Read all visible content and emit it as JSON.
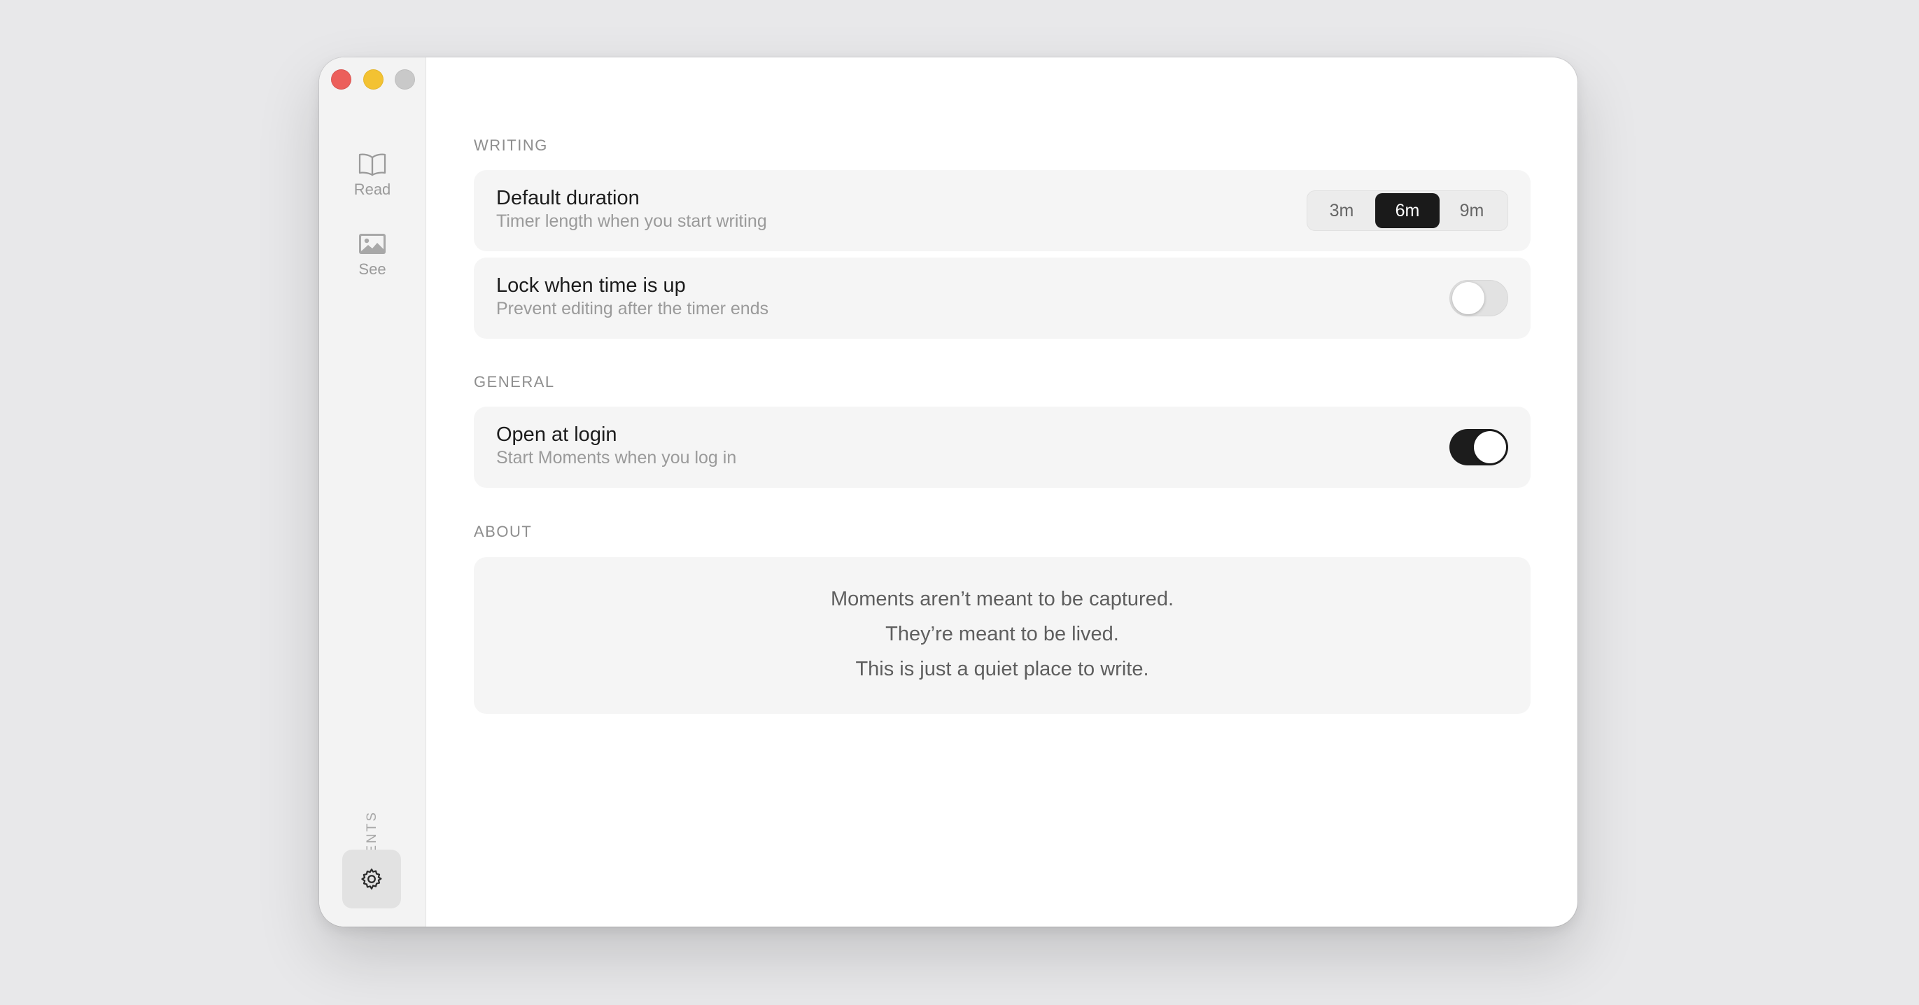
{
  "app": {
    "brand": "MOMENTS"
  },
  "window": {
    "traffic_lights": {
      "close": "#ec5f5b",
      "minimize": "#f3c232",
      "maximize": "#c9c9c9"
    }
  },
  "sidebar": {
    "items": [
      {
        "label": "Read",
        "icon": "book-icon"
      },
      {
        "label": "See",
        "icon": "image-icon"
      }
    ],
    "settings_icon": "gear-icon"
  },
  "settings": {
    "writing": {
      "title": "WRITING",
      "default_duration": {
        "title": "Default duration",
        "subtitle": "Timer length when you start writing",
        "options": [
          "3m",
          "6m",
          "9m"
        ],
        "selected": "6m"
      },
      "lock": {
        "title": "Lock when time is up",
        "subtitle": "Prevent editing after the timer ends",
        "enabled": false
      }
    },
    "general": {
      "title": "GENERAL",
      "open_at_login": {
        "title": "Open at login",
        "subtitle": "Start Moments when you log in",
        "enabled": true
      }
    },
    "about": {
      "title": "ABOUT",
      "lines": [
        "Moments aren’t meant to be captured.",
        "They’re meant to be lived.",
        "This is just a quiet place to write."
      ]
    }
  },
  "colors": {
    "accent": "#1a1a1a",
    "background": "#e8e8ea",
    "card": "#f5f5f5"
  }
}
